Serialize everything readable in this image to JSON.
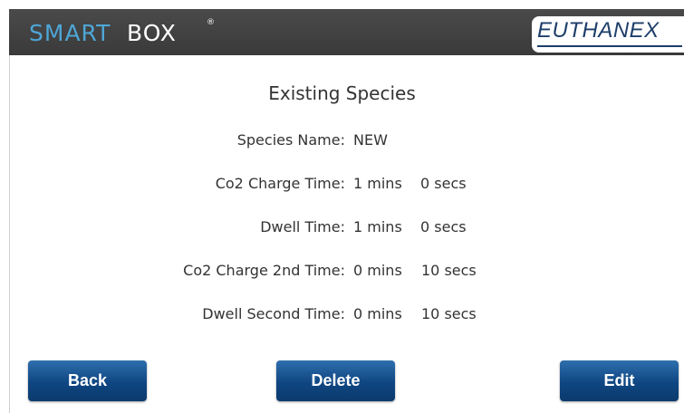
{
  "header": {
    "brand_part1": "SMART",
    "brand_part2": "BOX",
    "brand_mark": "®",
    "logo_text": "EUTHANEX"
  },
  "page": {
    "title": "Existing Species"
  },
  "fields": [
    {
      "label": "Species Name:",
      "value1": "NEW",
      "value2": ""
    },
    {
      "label": "Co2 Charge Time:",
      "value1": "1 mins",
      "value2": "0 secs"
    },
    {
      "label": "Dwell Time:",
      "value1": "1 mins",
      "value2": "0 secs"
    },
    {
      "label": "Co2 Charge 2nd Time:",
      "value1": "0 mins",
      "value2": "10 secs"
    },
    {
      "label": "Dwell Second Time:",
      "value1": "0 mins",
      "value2": "10 secs"
    }
  ],
  "buttons": {
    "back": "Back",
    "delete": "Delete",
    "edit": "Edit"
  },
  "colors": {
    "header_bg": "#3f3f3f",
    "brand_accent": "#4ea6d6",
    "button_bg": "#0f4682",
    "logo_blue": "#1e3e6a"
  }
}
